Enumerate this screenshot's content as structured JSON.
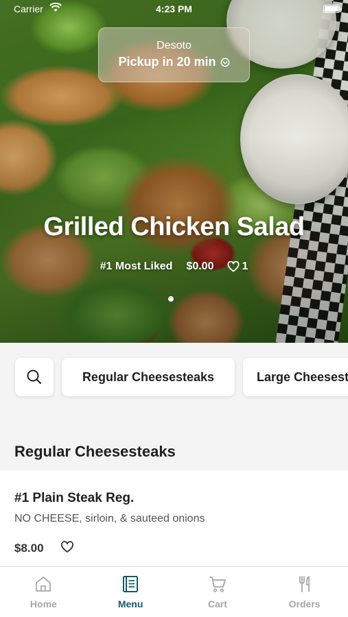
{
  "status_bar": {
    "carrier": "Carrier",
    "time": "4:23 PM"
  },
  "location": {
    "name": "Desoto",
    "pickup": "Pickup in 20 min"
  },
  "hero": {
    "title": "Grilled Chicken Salad",
    "badge": "#1 Most Liked",
    "price": "$0.00",
    "likes": "1",
    "page_index": 1,
    "page_count": 1
  },
  "categories": [
    "Regular Cheesesteaks",
    "Large Cheesesteaks"
  ],
  "section": {
    "title": "Regular Cheesesteaks",
    "items": [
      {
        "name": "#1 Plain Steak Reg.",
        "description": "NO CHEESE, sirloin, & sauteed onions",
        "price": "$8.00"
      }
    ]
  },
  "tabs": [
    {
      "label": "Home",
      "icon": "home-icon",
      "active": false
    },
    {
      "label": "Menu",
      "icon": "menu-book-icon",
      "active": true
    },
    {
      "label": "Cart",
      "icon": "cart-icon",
      "active": false
    },
    {
      "label": "Orders",
      "icon": "utensils-icon",
      "active": false
    }
  ],
  "colors": {
    "accent": "#0f5b66",
    "inactive": "#a7a7a7",
    "background": "#f4f4f4"
  }
}
